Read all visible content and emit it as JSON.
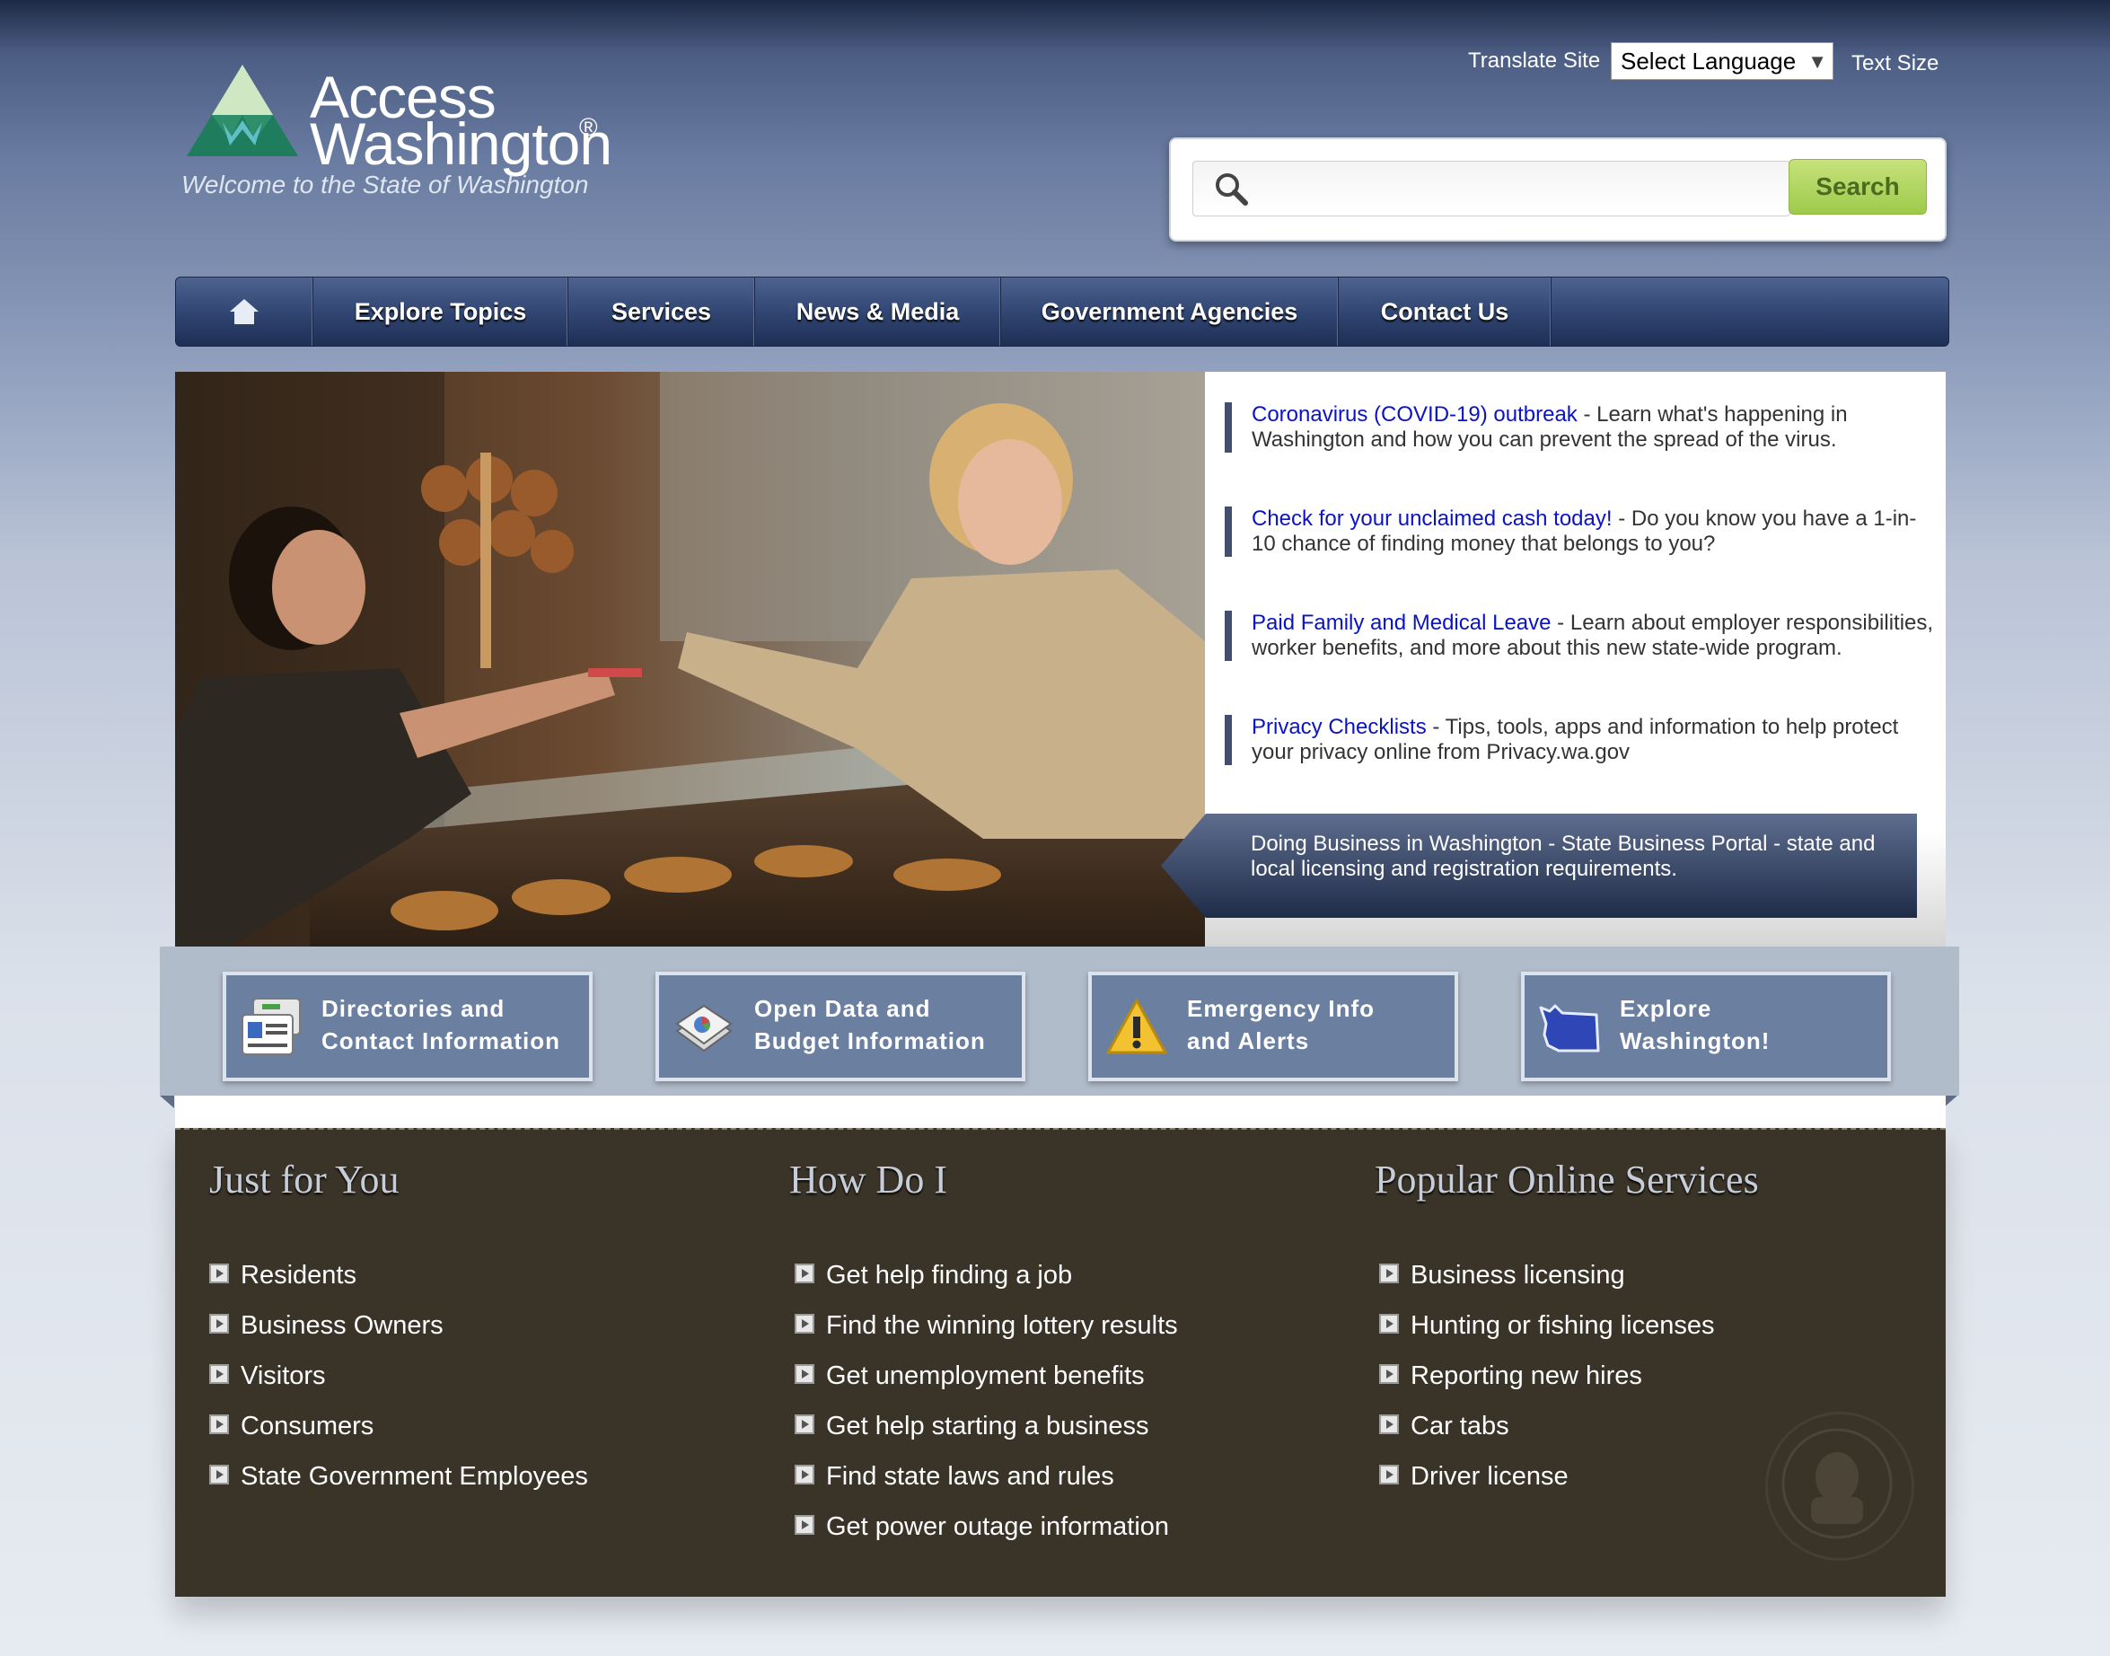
{
  "header": {
    "logo_line1": "Access",
    "logo_line2": "Washington",
    "logo_reg": "®",
    "tagline": "Welcome to the State of Washington",
    "translate_label": "Translate Site",
    "language_select": "Select Language",
    "text_size_label": "Text Size",
    "search": {
      "placeholder": "",
      "button": "Search",
      "icon": "search-icon"
    }
  },
  "nav": {
    "home_icon": "home-icon",
    "items": [
      "Explore Topics",
      "Services",
      "News & Media",
      "Government Agencies",
      "Contact Us"
    ]
  },
  "hero": {
    "news": [
      {
        "link": "Coronavirus (COVID-19) outbreak",
        "text": " - Learn what's happening in Washington and how you can prevent the spread of the virus."
      },
      {
        "link": "Check for your unclaimed cash today!",
        "text": " - Do you know you have a 1-in-10 chance of finding money that belongs to you?"
      },
      {
        "link": "Paid Family and Medical Leave",
        "text": " - Learn about employer responsibilities, worker benefits, and more about this new state-wide program."
      },
      {
        "link": "Privacy Checklists",
        "text": " - Tips, tools, apps and information to help protect your privacy online from Privacy.wa.gov"
      }
    ],
    "business_banner": "Doing Business in Washington - State Business Portal - state and local licensing and registration requirements."
  },
  "quick_links": [
    {
      "line1": "Directories and",
      "line2": "Contact Information",
      "icon": "directory-card-icon"
    },
    {
      "line1": "Open Data and",
      "line2": "Budget Information",
      "icon": "data-stack-icon"
    },
    {
      "line1": "Emergency Info",
      "line2": "and Alerts",
      "icon": "warning-icon"
    },
    {
      "line1": "Explore",
      "line2": "Washington!",
      "icon": "washington-map-icon"
    }
  ],
  "columns": [
    {
      "title": "Just for You",
      "items": [
        "Residents",
        "Business Owners",
        "Visitors",
        "Consumers",
        "State Government Employees"
      ]
    },
    {
      "title": "How Do I",
      "items": [
        "Get help finding a job",
        "Find the winning lottery results",
        "Get unemployment benefits",
        "Get help starting a business",
        "Find state laws and rules",
        "Get power outage information"
      ]
    },
    {
      "title": "Popular Online Services",
      "items": [
        "Business licensing",
        "Hunting or fishing licenses",
        "Reporting new hires",
        "Car tabs",
        "Driver license"
      ]
    }
  ],
  "colors": {
    "link": "#0b13c6",
    "nav_dark": "#1e2f55",
    "bottom_panel": "#3a3428",
    "search_green": "#9ccb4a"
  }
}
